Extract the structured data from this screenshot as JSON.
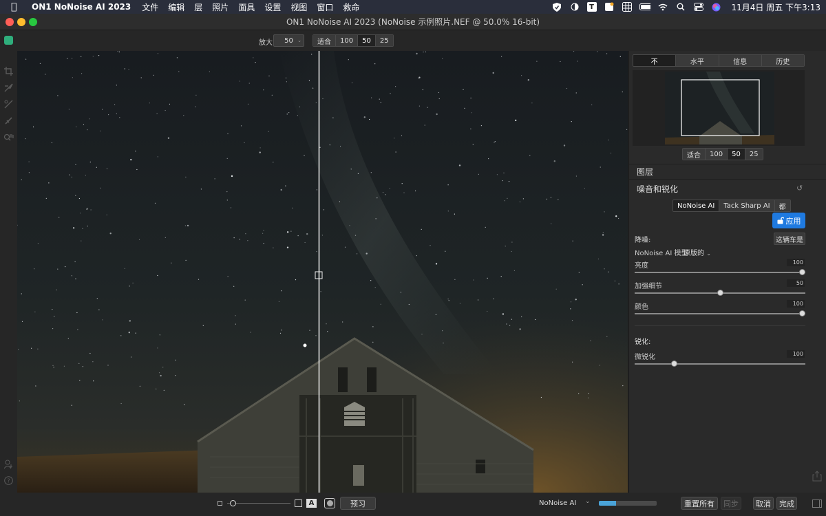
{
  "menubar": {
    "app_name": "ON1 NoNoise AI 2023",
    "items": [
      "文件",
      "编辑",
      "层",
      "照片",
      "面具",
      "设置",
      "视图",
      "窗口",
      "救命"
    ],
    "clock": "11月4日 周五 下午3:13",
    "t_icon": "T"
  },
  "window": {
    "title": "ON1 NoNoise AI 2023 (NoNoise 示例照片.NEF @ 50.0% 16-bit)"
  },
  "toolbar": {
    "zoom_label": "放大",
    "zoom_value": "50",
    "zoom_options": [
      "适合",
      "100",
      "50",
      "25"
    ],
    "zoom_active": "50"
  },
  "panel": {
    "tabs": [
      "不",
      "水平",
      "信息",
      "历史"
    ],
    "active_tab": "不",
    "nav_zoom_options": [
      "适合",
      "100",
      "50",
      "25"
    ],
    "layers_title": "图层",
    "section_title": "噪音和锐化",
    "mode_tabs": [
      "NoNoise AI",
      "Tack Sharp AI",
      "都"
    ],
    "apply_label": "应用",
    "noise_heading": "降噪:",
    "auto_button": "这辆车是",
    "model_label": "NoNoise AI 模型",
    "model_value": "原版的",
    "sliders": [
      {
        "label": "亮度",
        "value": "100",
        "fraction": 1.0
      },
      {
        "label": "加强细节",
        "value": "50",
        "fraction": 0.5
      },
      {
        "label": "颜色",
        "value": "100",
        "fraction": 1.0
      }
    ],
    "sharpen_heading": "锐化:",
    "sharpen_slider": {
      "label": "微锐化",
      "value": "100",
      "fraction": 0.22
    }
  },
  "bottombar": {
    "preview_label": "预习",
    "view_a_label": "A",
    "process_label": "NoNoise AI",
    "progress": 0.3,
    "reset_label": "重置所有",
    "sync_label": "同步",
    "cancel_label": "取消",
    "done_label": "完成"
  },
  "colors": {
    "accent": "#1f7ae0",
    "progress": "#4aa3d8"
  }
}
